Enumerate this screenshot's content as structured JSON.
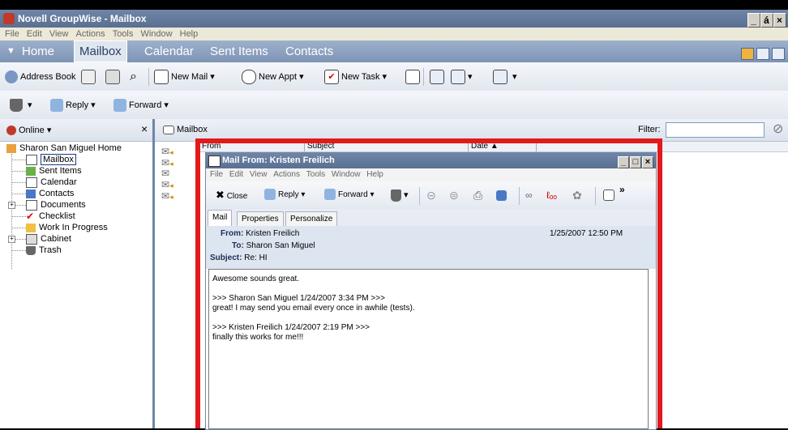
{
  "app": {
    "title": "Novell GroupWise - Mailbox",
    "window_controls": [
      "_",
      "á",
      "×"
    ]
  },
  "menubar": [
    "File",
    "Edit",
    "View",
    "Actions",
    "Tools",
    "Window",
    "Help"
  ],
  "nav": {
    "tabs": [
      "Home",
      "Mailbox",
      "Calendar",
      "Sent Items",
      "Contacts"
    ],
    "active": "Mailbox"
  },
  "toolbar1": {
    "address_book": "Address Book",
    "new_mail": "New Mail",
    "new_appt": "New Appt",
    "new_task": "New Task"
  },
  "toolbar2": {
    "reply": "Reply",
    "forward": "Forward"
  },
  "left_pane": {
    "status": "Online",
    "close": "×",
    "tree": [
      {
        "label": "Sharon San Miguel Home",
        "icon": "home-icon"
      },
      {
        "label": "Mailbox",
        "icon": "mailbox-icon",
        "selected": true
      },
      {
        "label": "Sent Items",
        "icon": "sent-items-icon"
      },
      {
        "label": "Calendar",
        "icon": "calendar-icon"
      },
      {
        "label": "Contacts",
        "icon": "contacts-icon"
      },
      {
        "label": "Documents",
        "icon": "documents-icon",
        "expandable": true
      },
      {
        "label": "Checklist",
        "icon": "checklist-icon"
      },
      {
        "label": "Work In Progress",
        "icon": "work-in-progress-icon"
      },
      {
        "label": "Cabinet",
        "icon": "cabinet-icon",
        "expandable": true
      },
      {
        "label": "Trash",
        "icon": "trash-icon"
      }
    ]
  },
  "right_pane": {
    "folder": "Mailbox",
    "filter_label": "Filter:",
    "columns": [
      "From",
      "Subject",
      "Date ▲"
    ]
  },
  "mail_window": {
    "title": "Mail From: Kristen Freilich",
    "window_controls": [
      "_",
      "□",
      "×"
    ],
    "menubar": [
      "File",
      "Edit",
      "View",
      "Actions",
      "Tools",
      "Window",
      "Help"
    ],
    "toolbar": {
      "close": "Close",
      "reply": "Reply",
      "forward": "Forward",
      "more": "»"
    },
    "tabs": [
      "Mail",
      "Properties",
      "Personalize"
    ],
    "header": {
      "from_label": "From:",
      "from": "Kristen Freilich",
      "to_label": "To:",
      "to": "Sharon San Miguel",
      "subject_label": "Subject:",
      "subject": "Re: HI",
      "date": "1/25/2007 12:50 PM"
    },
    "body_lines": [
      "Awesome sounds great.",
      "",
      ">>> Sharon San Miguel 1/24/2007 3:34 PM >>>",
      "great!  I may send you email every once in awhile (tests).",
      "",
      ">>> Kristen Freilich 1/24/2007 2:19 PM >>>",
      "finally this works for me!!!"
    ]
  },
  "colors": {
    "accent": "#6f86a8",
    "highlight": "#e3191c"
  }
}
